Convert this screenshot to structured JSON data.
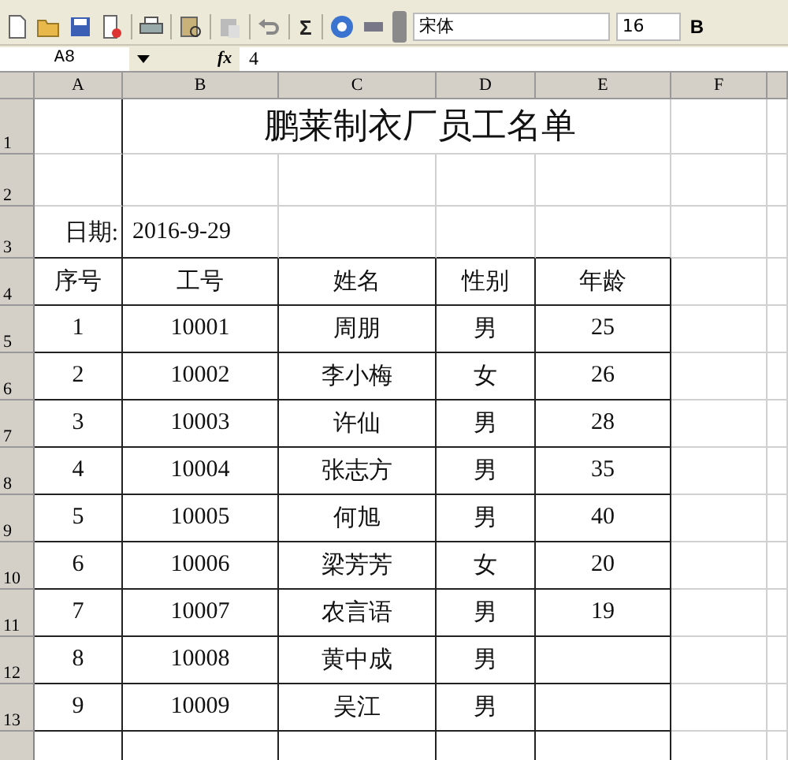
{
  "toolbar": {
    "sum": "Σ",
    "font": "宋体",
    "font_size": "16",
    "bold": "B"
  },
  "formula_bar": {
    "name_box": "A8",
    "fx": "fx",
    "formula": "4"
  },
  "columns": [
    "A",
    "B",
    "C",
    "D",
    "E",
    "F"
  ],
  "row_numbers": [
    "1",
    "2",
    "3",
    "4",
    "5",
    "6",
    "7",
    "8",
    "9",
    "10",
    "11",
    "12",
    "13"
  ],
  "sheet": {
    "title": "鹏莱制衣厂员工名单",
    "date_label": "日期:",
    "date": "2016-9-29",
    "header": [
      "序号",
      "工号",
      "姓名",
      "性别",
      "年龄"
    ],
    "rows": [
      {
        "no": "1",
        "id": "10001",
        "name": "周朋",
        "gender": "男",
        "age": "25"
      },
      {
        "no": "2",
        "id": "10002",
        "name": "李小梅",
        "gender": "女",
        "age": "26"
      },
      {
        "no": "3",
        "id": "10003",
        "name": "许仙",
        "gender": "男",
        "age": "28"
      },
      {
        "no": "4",
        "id": "10004",
        "name": "张志方",
        "gender": "男",
        "age": "35"
      },
      {
        "no": "5",
        "id": "10005",
        "name": "何旭",
        "gender": "男",
        "age": "40"
      },
      {
        "no": "6",
        "id": "10006",
        "name": "梁芳芳",
        "gender": "女",
        "age": "20"
      },
      {
        "no": "7",
        "id": "10007",
        "name": "农言语",
        "gender": "男",
        "age": "19"
      },
      {
        "no": "8",
        "id": "10008",
        "name": "黄中成",
        "gender": "男"
      },
      {
        "no": "9",
        "id": "10009",
        "name": "吴江",
        "gender": "男"
      }
    ]
  }
}
